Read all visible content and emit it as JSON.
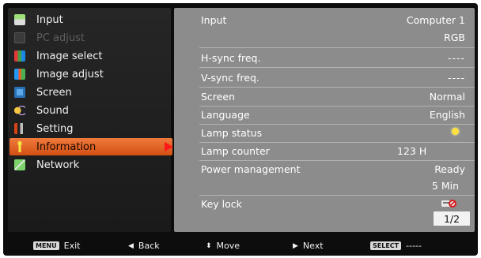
{
  "menu": {
    "items": [
      {
        "label": "Input",
        "icon": "input-icon"
      },
      {
        "label": "PC adjust",
        "icon": "pc-adjust-icon",
        "disabled": true
      },
      {
        "label": "Image select",
        "icon": "image-select-icon"
      },
      {
        "label": "Image adjust",
        "icon": "image-adjust-icon"
      },
      {
        "label": "Screen",
        "icon": "screen-icon"
      },
      {
        "label": "Sound",
        "icon": "sound-icon"
      },
      {
        "label": "Setting",
        "icon": "setting-icon"
      },
      {
        "label": "Information",
        "icon": "information-icon",
        "selected": true
      },
      {
        "label": "Network",
        "icon": "network-icon"
      }
    ]
  },
  "info": {
    "input": {
      "label": "Input",
      "value": "Computer 1",
      "value2": "RGB"
    },
    "hsync": {
      "label": "H-sync freq.",
      "value": "----"
    },
    "vsync": {
      "label": "V-sync freq.",
      "value": "----"
    },
    "screen": {
      "label": "Screen",
      "value": "Normal"
    },
    "language": {
      "label": "Language",
      "value": "English"
    },
    "lamp_status": {
      "label": "Lamp status",
      "icon": "lamp-bulb-icon"
    },
    "lamp_counter": {
      "label": "Lamp counter",
      "value": "123 H"
    },
    "power": {
      "label": "Power management",
      "value": "Ready",
      "value2": "5 Min"
    },
    "key_lock": {
      "label": "Key lock",
      "icon": "key-lock-icon"
    },
    "page": "1/2"
  },
  "bottom_bar": {
    "exit": {
      "tag": "MENU",
      "label": "Exit"
    },
    "back": {
      "label": "Back"
    },
    "move": {
      "label": "Move"
    },
    "next": {
      "label": "Next"
    },
    "select": {
      "tag": "SELECT",
      "label": "-----"
    }
  },
  "colors": {
    "highlight": "#e0622a",
    "panel": "#8c8c8c",
    "menu_bg": "#222222",
    "arrow": "#ff1a1a"
  }
}
